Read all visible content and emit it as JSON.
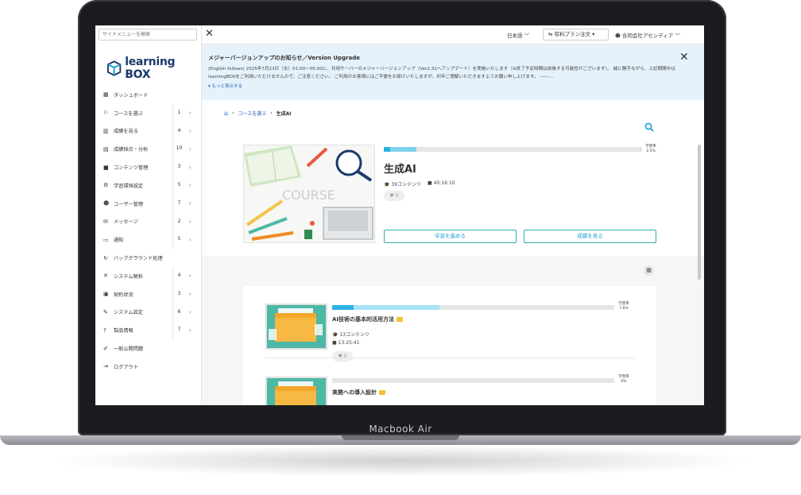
{
  "device": {
    "label": "Macbook Air"
  },
  "sidebar": {
    "search_placeholder": "サイドメニューを検索",
    "logo": {
      "text": "learning",
      "bold": "BOX"
    },
    "items": [
      {
        "icon": "▦",
        "label": "ダッシュボード",
        "count": "",
        "chevron": false
      },
      {
        "icon": "⚐",
        "label": "コースを選ぶ",
        "count": "1",
        "chevron": true
      },
      {
        "icon": "▥",
        "label": "成績を見る",
        "count": "4",
        "chevron": true
      },
      {
        "icon": "▤",
        "label": "成績採点・分析",
        "count": "10",
        "chevron": true
      },
      {
        "icon": "■",
        "label": "コンテンツ管理",
        "count": "3",
        "chevron": true
      },
      {
        "icon": "⚙",
        "label": "学習環境設定",
        "count": "5",
        "chevron": true
      },
      {
        "icon": "☻",
        "label": "ユーザー管理",
        "count": "7",
        "chevron": true
      },
      {
        "icon": "✉",
        "label": "メッセージ",
        "count": "2",
        "chevron": true
      },
      {
        "icon": "▭",
        "label": "通知",
        "count": "5",
        "chevron": true
      },
      {
        "icon": "↻",
        "label": "バックグラウンド処理",
        "count": "",
        "chevron": false
      },
      {
        "icon": "✕",
        "label": "システム解析",
        "count": "4",
        "chevron": true
      },
      {
        "icon": "▣",
        "label": "契約状況",
        "count": "3",
        "chevron": true
      },
      {
        "icon": "✎",
        "label": "システム設定",
        "count": "6",
        "chevron": true
      },
      {
        "icon": "?",
        "label": "製品情報",
        "count": "7",
        "chevron": true
      },
      {
        "icon": "✐",
        "label": "一般公開問題",
        "count": "",
        "chevron": false
      },
      {
        "icon": "⇥",
        "label": "ログアウト",
        "count": "",
        "chevron": false
      }
    ]
  },
  "topbar": {
    "close": "✕",
    "language": "日本語 ﹀",
    "plan_button": "⇆ 有料プラン注文 ▾",
    "user": "☻ 合同会社アセンディア ﹀"
  },
  "notice": {
    "title": "メジャーバージョンアップのお知らせ／Version Upgrade",
    "body": "(English follows) 2025年7月23日（水）01:00～05:00に、共用サーバーのメジャーバージョンアップ（Ver2.32へアップデート）を実施いたします（※終了予定時間は前後する可能性がございます）。 誠に勝手ながら、上記期間中はlearningBOXをご利用いただけませんので、ご注意ください。 ご利用のお客様にはご不便をお掛けいたしますが、何卒ご理解いただきますようお願い申し上げます。 ------...",
    "more": "▾ もっと表示する",
    "close": "✕"
  },
  "breadcrumb": {
    "home": "⌂",
    "link": "コースを選ぶ",
    "current": "生成AI"
  },
  "course": {
    "title": "生成AI",
    "contents": "39コンテンツ",
    "duration": "40:16:10",
    "likes": "0",
    "rate_label": "学習率",
    "rate_value": "2.5%",
    "progress": 0.025,
    "image_text": "COURSE",
    "start_button": "学習を進める",
    "grades_button": "成績を見る"
  },
  "items": [
    {
      "title": "AI技術の基本的活用方法",
      "contents": "13コンテンツ",
      "duration": "13:25:41",
      "likes": "0",
      "rate_label": "学習率",
      "rate_value": "7.6%",
      "progress": 0.076
    },
    {
      "title": "実務への導入設計",
      "rate_label": "学習率",
      "rate_value": "0%",
      "progress": 0.0
    }
  ],
  "colors": {
    "accent": "#2bb3e6",
    "teal": "#4db8a6",
    "folder": "#f4a62a"
  }
}
